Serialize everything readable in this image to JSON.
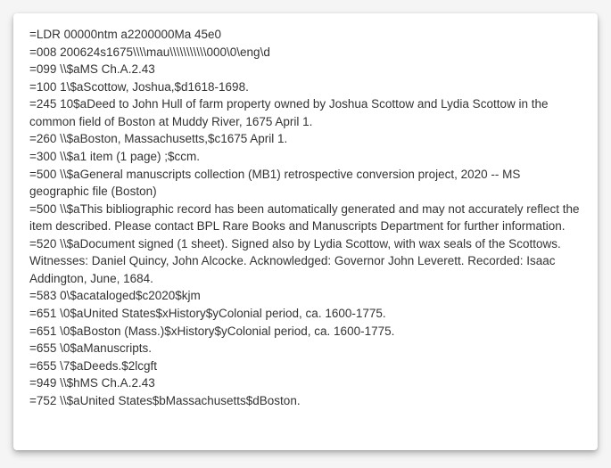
{
  "marc_fields": [
    {
      "text": "=LDR  00000ntm a2200000Ma 45e0"
    },
    {
      "text": "=008  200624s1675\\\\\\\\mau\\\\\\\\\\\\\\\\\\\\\\000\\0\\eng\\d"
    },
    {
      "text": "=099  \\\\$aMS Ch.A.2.43"
    },
    {
      "text": "=100  1\\$aScottow, Joshua,$d1618-1698."
    },
    {
      "text": "=245  10$aDeed to John Hull of farm property owned by Joshua Scottow and Lydia Scottow in the common field of Boston at Muddy River, 1675 April 1."
    },
    {
      "text": "=260  \\\\$aBoston, Massachusetts,$c1675 April 1."
    },
    {
      "text": "=300  \\\\$a1 item (1 page) ;$ccm."
    },
    {
      "text": "=500  \\\\$aGeneral manuscripts collection (MB1) retrospective conversion project, 2020 -- MS geographic file (Boston)"
    },
    {
      "text": "=500  \\\\$aThis bibliographic record has been automatically generated and may not accurately reflect the item described. Please contact BPL Rare Books and Manuscripts Department for further information."
    },
    {
      "text": "=520  \\\\$aDocument signed (1 sheet). Signed also by Lydia Scottow, with wax seals of the Scottows. Witnesses: Daniel Quincy, John Alcocke. Acknowledged: Governor John Leverett. Recorded: Isaac Addington, June, 1684."
    },
    {
      "text": "=583  0\\$acataloged$c2020$kjm"
    },
    {
      "text": "=651  \\0$aUnited States$xHistory$yColonial period, ca. 1600-1775."
    },
    {
      "text": "=651  \\0$aBoston (Mass.)$xHistory$yColonial period, ca. 1600-1775."
    },
    {
      "text": "=655  \\0$aManuscripts."
    },
    {
      "text": "=655  \\7$aDeeds.$2lcgft"
    },
    {
      "text": "=949  \\\\$hMS Ch.A.2.43"
    },
    {
      "text": "=752  \\\\$aUnited States$bMassachusetts$dBoston."
    }
  ]
}
